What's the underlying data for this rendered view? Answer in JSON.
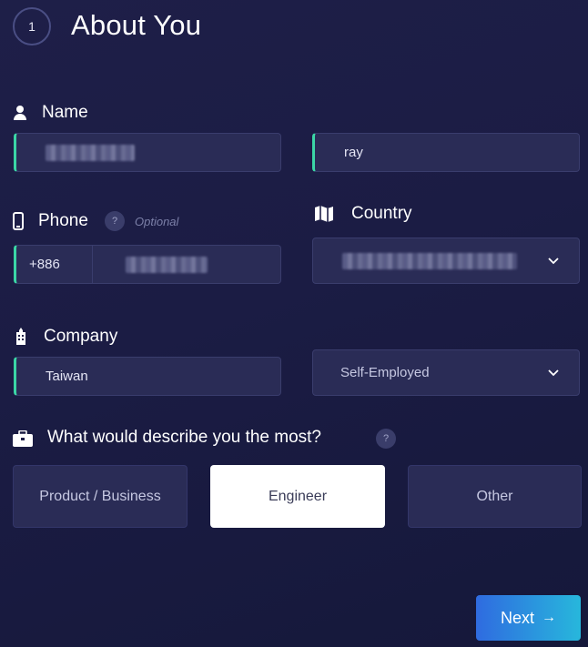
{
  "step": {
    "number": "1",
    "title": "About You"
  },
  "name": {
    "label": "Name",
    "icon": "person-icon",
    "first_value": "",
    "last_value": "ray"
  },
  "phone": {
    "label": "Phone",
    "icon": "phone-icon",
    "help": "?",
    "optional": "Optional",
    "country_code": "+886",
    "number_value": ""
  },
  "country": {
    "label": "Country",
    "icon": "map-icon",
    "selected": ""
  },
  "company": {
    "label": "Company",
    "icon": "building-icon",
    "name_value": "Taiwan",
    "type_selected": "Self-Employed"
  },
  "describe": {
    "question": "What would describe you the most?",
    "icon": "briefcase-icon",
    "help": "?",
    "options": [
      "Product / Business",
      "Engineer",
      "Other"
    ],
    "selected_index": 1
  },
  "footer": {
    "next_label": "Next",
    "next_arrow": "→"
  },
  "colors": {
    "accent": "#3bd6a6",
    "field_bg": "#2a2c56",
    "next_start": "#2f6be0",
    "next_end": "#27b7dc"
  }
}
